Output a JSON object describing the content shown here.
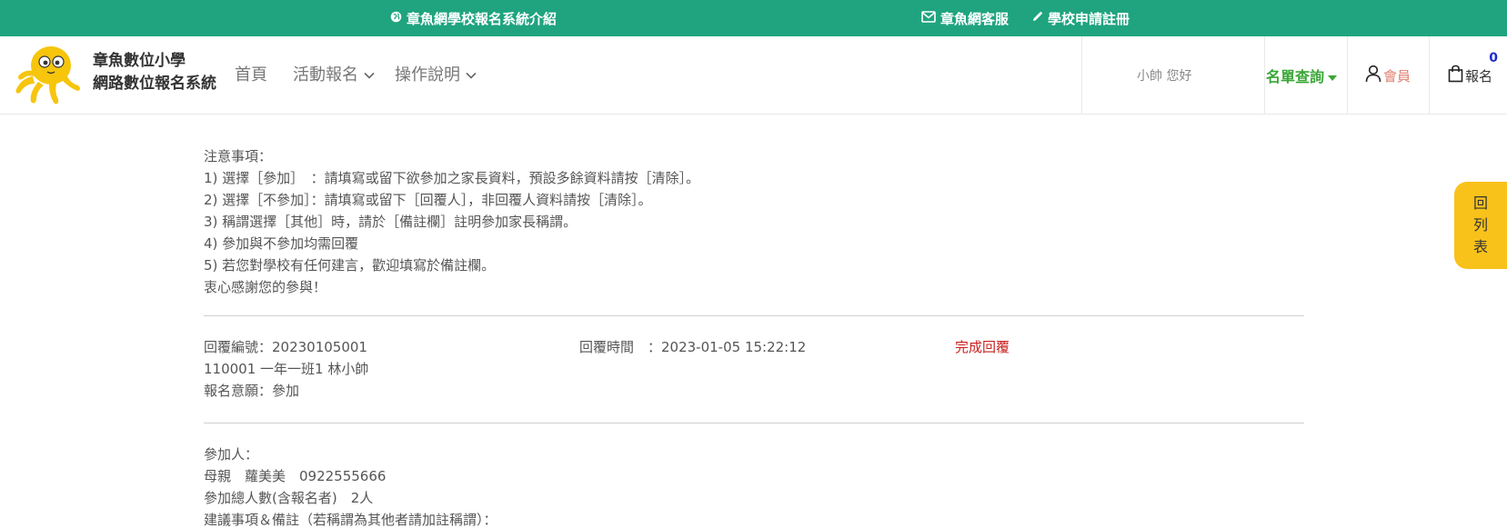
{
  "topbar": {
    "intro_label": "章魚網學校報名系統介紹",
    "service_label": "章魚網客服",
    "register_label": "學校申請註冊",
    "bg_color": "#1fa47f"
  },
  "header": {
    "site_name_line1": "章魚數位小學",
    "site_name_line2": "網路數位報名系統",
    "nav": {
      "home": "首頁",
      "activity": "活動報名",
      "guide": "操作說明"
    },
    "greeting": "小帥 您好",
    "query_label": "名單查詢",
    "member_label": "會員",
    "signup_label": "報名",
    "cart_count": "0"
  },
  "notes": {
    "title": "注意事項：",
    "items": [
      "1) 選擇［參加］　：請填寫或留下欲參加之家長資料，預設多餘資料請按［清除］。",
      "2) 選擇［不參加］：請填寫或留下［回覆人］，非回覆人資料請按［清除］。",
      "3) 稱謂選擇［其他］時，請於［備註欄］註明參加家長稱謂。",
      "4) 參加與不參加均需回覆",
      "5) 若您對學校有任何建言，歡迎填寫於備註欄。"
    ],
    "thanks": "衷心感謝您的參與！"
  },
  "reply": {
    "number": "回覆編號：20230105001",
    "time": "回覆時間　：2023-01-05 15:22:12",
    "status": "完成回覆",
    "student": "110001 一年一班1 林小帥",
    "intent": "報名意願：參加"
  },
  "participants": {
    "title": "參加人：",
    "person": "母親　蘿美美　0922555666",
    "total": "參加總人數(含報名者)　2人",
    "remarks_label": "建議事項＆備註（若稱謂為其他者請加註稱謂）："
  },
  "back_button": {
    "chars": [
      "回",
      "列",
      "表"
    ]
  },
  "colors": {
    "accent_green": "#39a635",
    "status_red": "#c8201e",
    "back_yellow": "#f9c21b",
    "cart_blue": "#1c2cc8"
  },
  "icons": [
    "globe-icon",
    "envelope-icon",
    "pencil-icon",
    "chevron-down-icon",
    "caret-down-icon",
    "user-icon",
    "shopping-bag-icon",
    "octopus-logo"
  ]
}
